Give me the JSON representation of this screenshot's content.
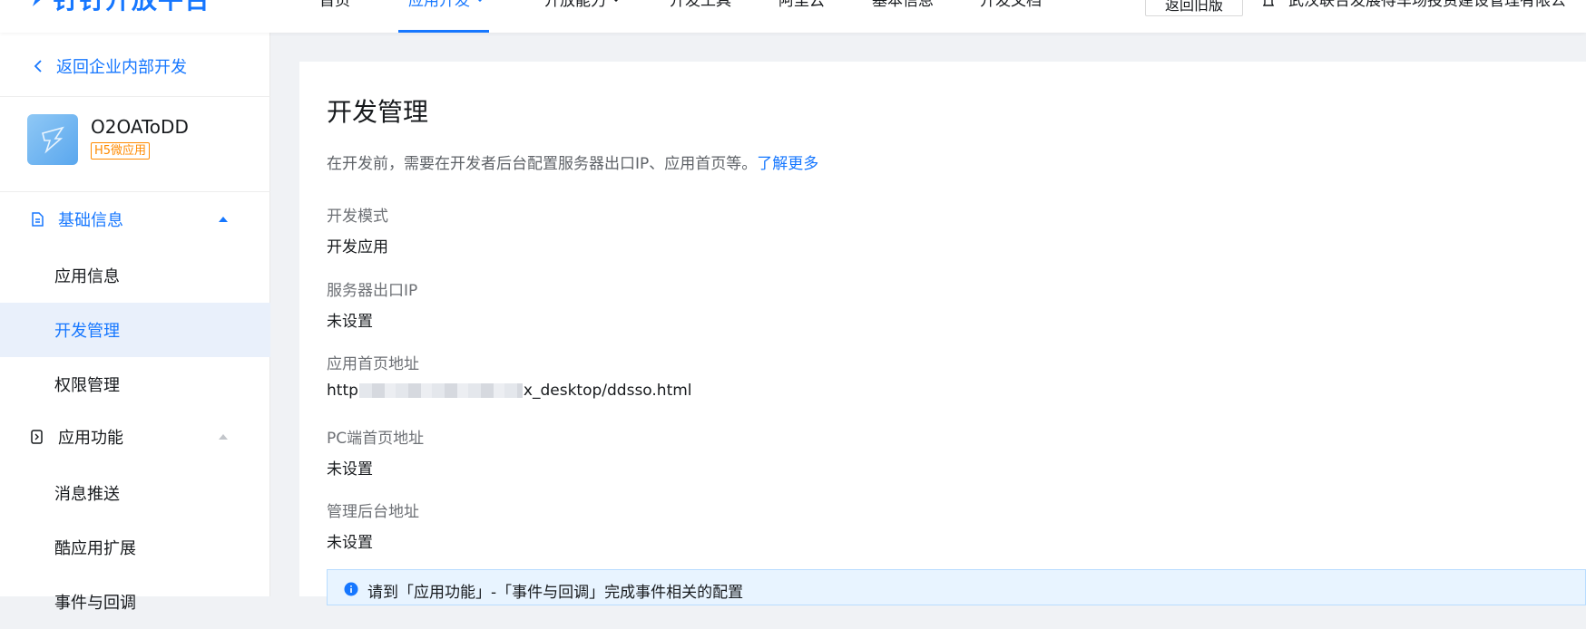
{
  "brand": {
    "name": "钉钉开放平台",
    "color": "#1677ff"
  },
  "topnav": {
    "items": [
      {
        "label": "首页",
        "active": false,
        "caret": false
      },
      {
        "label": "应用开发",
        "active": true,
        "caret": true
      },
      {
        "label": "开放能力",
        "active": false,
        "caret": true
      },
      {
        "label": "开发工具",
        "active": false,
        "caret": false
      },
      {
        "label": "阿里云",
        "active": false,
        "caret": false
      },
      {
        "label": "基本信息",
        "active": false,
        "caret": false
      },
      {
        "label": "开发文档",
        "active": false,
        "caret": false
      }
    ],
    "back_old_label": "返回旧版",
    "org_name": "武汉联合发展得车场投资建设管理有限公"
  },
  "sidebar": {
    "back_label": "返回企业内部开发",
    "app": {
      "name": "O2OAToDD",
      "badge": "H5微应用",
      "icon": "app-logo-icon"
    },
    "groups": [
      {
        "label": "基础信息",
        "icon": "document-icon",
        "expanded": true,
        "active": true,
        "items": [
          {
            "label": "应用信息",
            "selected": false
          },
          {
            "label": "开发管理",
            "selected": true
          },
          {
            "label": "权限管理",
            "selected": false
          }
        ]
      },
      {
        "label": "应用功能",
        "icon": "phone-function-icon",
        "expanded": true,
        "active": false,
        "items": [
          {
            "label": "消息推送",
            "selected": false
          },
          {
            "label": "酷应用扩展",
            "selected": false
          },
          {
            "label": "事件与回调",
            "selected": false
          }
        ]
      }
    ]
  },
  "main": {
    "title": "开发管理",
    "intro_text": "在开发前，需要在开发者后台配置服务器出口IP、应用首页等。",
    "intro_link": "了解更多",
    "fields": [
      {
        "label": "开发模式",
        "value": "开发应用"
      },
      {
        "label": "服务器出口IP",
        "value": "未设置"
      },
      {
        "label": "应用首页地址",
        "value_prefix": "http",
        "value_suffix": "x_desktop/ddsso.html"
      },
      {
        "label": "PC端首页地址",
        "value": "未设置"
      },
      {
        "label": "管理后台地址",
        "value": "未设置"
      }
    ],
    "notice": "请到「应用功能」-「事件与回调」完成事件相关的配置"
  },
  "colors": {
    "accent": "#1677ff",
    "selected_bg": "#e9f0fb",
    "notice_bg": "#e8f4ff",
    "badge": "#ff8a00"
  }
}
